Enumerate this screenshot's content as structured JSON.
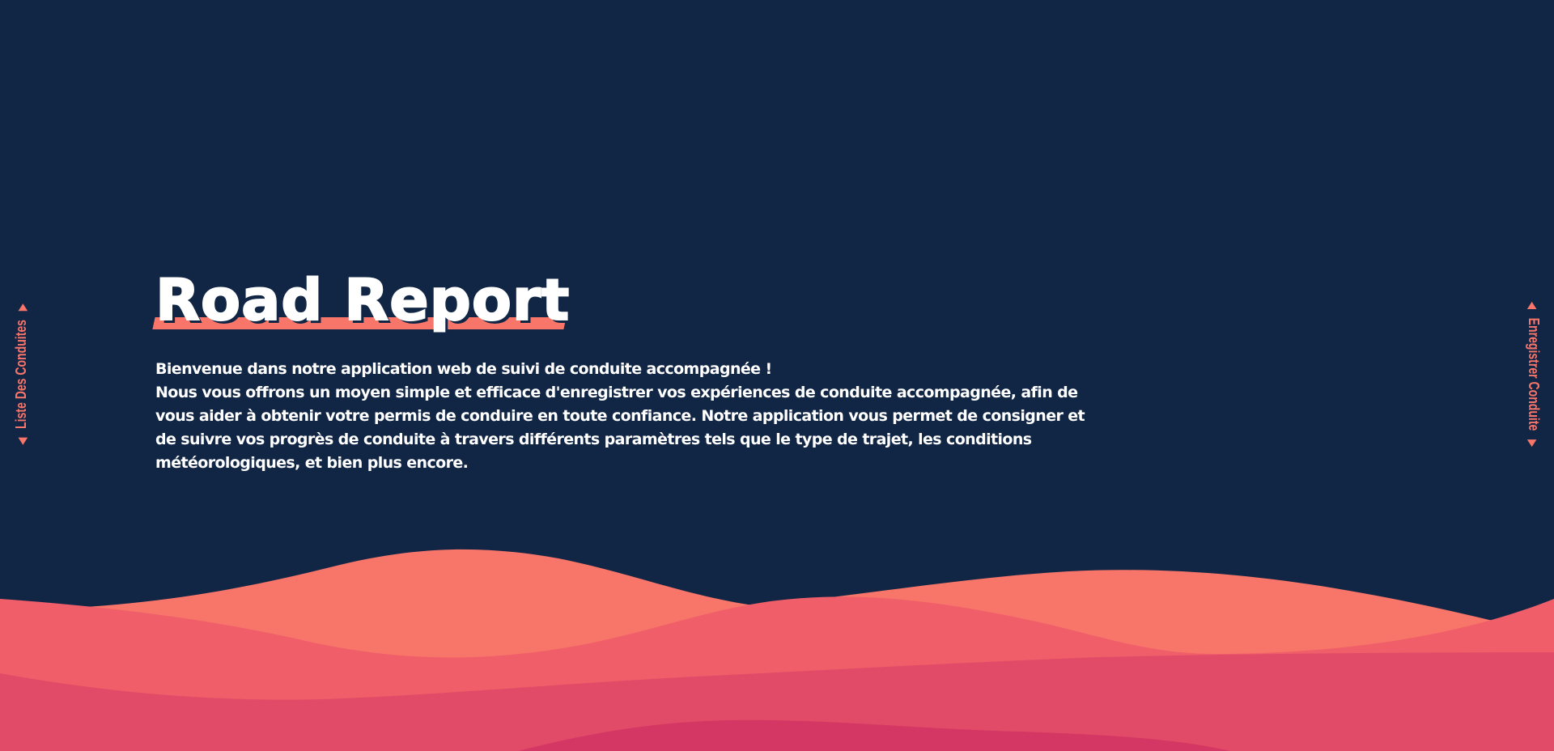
{
  "app": {
    "title": "Road Report"
  },
  "nav": {
    "left": {
      "label": "Liste Des Conduites",
      "arrow_icon": "triangle-arrow-icon"
    },
    "right": {
      "label": "Enregistrer Conduite",
      "arrow_icon": "triangle-arrow-icon"
    }
  },
  "intro": {
    "line1": "Bienvenue dans notre application web de suivi de conduite accompagnée !",
    "line2": "Nous vous offrons un moyen simple et efficace d'enregistrer vos expériences de conduite accompagnée, afin de vous aider à obtenir votre permis de conduire en toute confiance. Notre application vous permet de consigner et de suivre vos progrès de conduite à travers différents paramètres tels que le type de trajet, les conditions météorologiques, et bien plus encore."
  },
  "colors": {
    "background": "#112645",
    "accent": "#f8756a",
    "wave1": "#f8756a",
    "wave2": "#ef5e69",
    "wave3": "#e14b68",
    "wave4": "#d43764"
  }
}
